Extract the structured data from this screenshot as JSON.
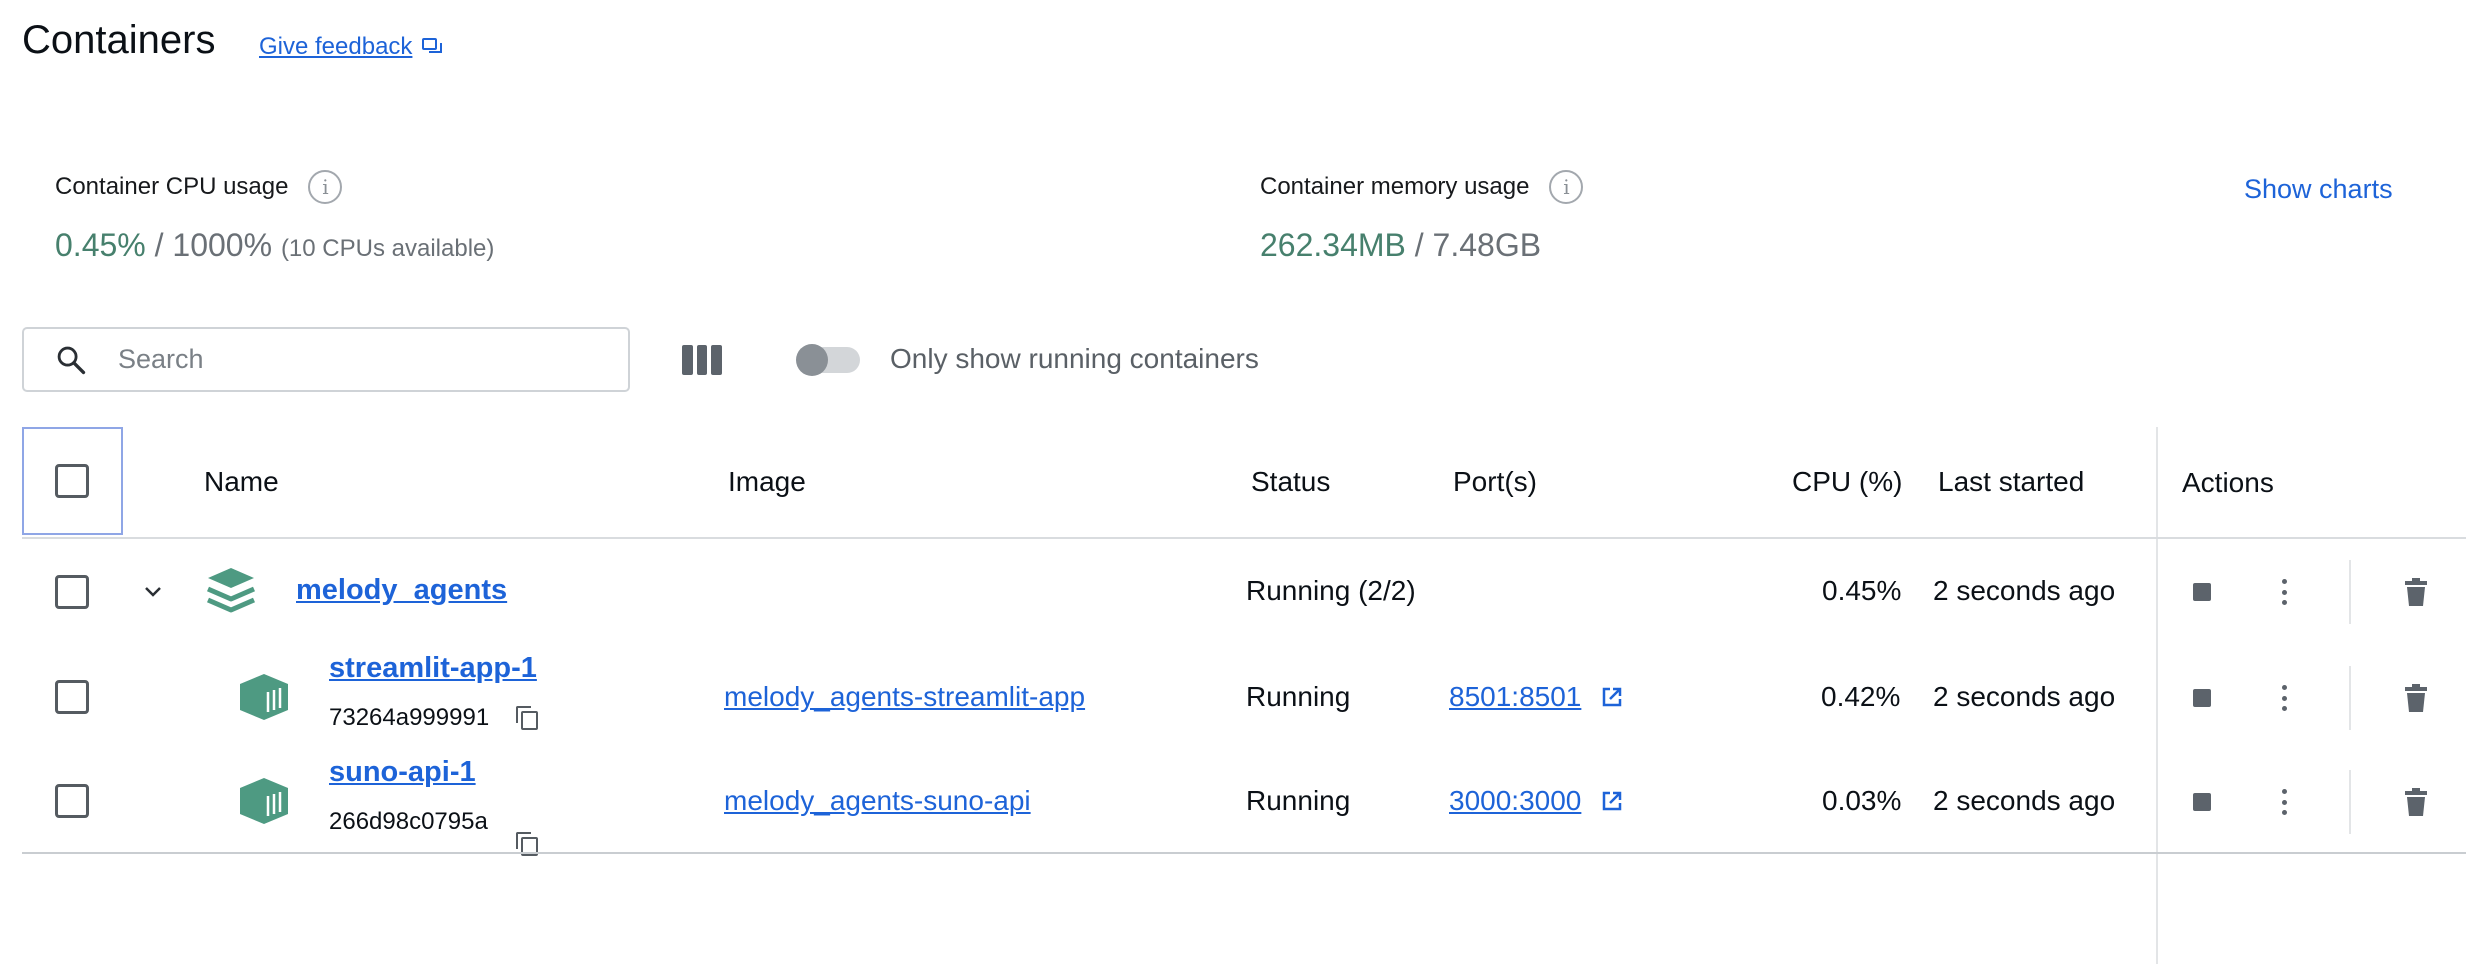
{
  "header": {
    "title": "Containers",
    "feedback_label": "Give feedback"
  },
  "stats": {
    "cpu": {
      "label": "Container CPU usage",
      "used": "0.45%",
      "separator": " / ",
      "total": "1000%",
      "note": "(10 CPUs available)"
    },
    "memory": {
      "label": "Container memory usage",
      "used": "262.34MB",
      "separator": " / ",
      "total": "7.48GB"
    },
    "show_charts_label": "Show charts"
  },
  "toolbar": {
    "search_placeholder": "Search",
    "toggle_label": "Only show running containers",
    "toggle_on": false
  },
  "table": {
    "columns": {
      "name": "Name",
      "image": "Image",
      "status": "Status",
      "ports": "Port(s)",
      "cpu": "CPU (%)",
      "last_started": "Last started",
      "actions": "Actions"
    },
    "group": {
      "name": "melody_agents",
      "status": "Running (2/2)",
      "cpu": "0.45%",
      "last_started": "2 seconds ago",
      "expanded": true
    },
    "rows": [
      {
        "name": "streamlit-app-1",
        "id": "73264a999991",
        "image": "melody_agents-streamlit-app",
        "status": "Running",
        "port": "8501:8501",
        "cpu": "0.42%",
        "last_started": "2 seconds ago"
      },
      {
        "name": "suno-api-1",
        "id": "266d98c0795a",
        "image": "melody_agents-suno-api",
        "status": "Running",
        "port": "3000:3000",
        "cpu": "0.03%",
        "last_started": "2 seconds ago"
      }
    ]
  },
  "colors": {
    "link": "#1d63d8",
    "usage_green": "#47806d",
    "container_icon": "#4e9a82"
  }
}
